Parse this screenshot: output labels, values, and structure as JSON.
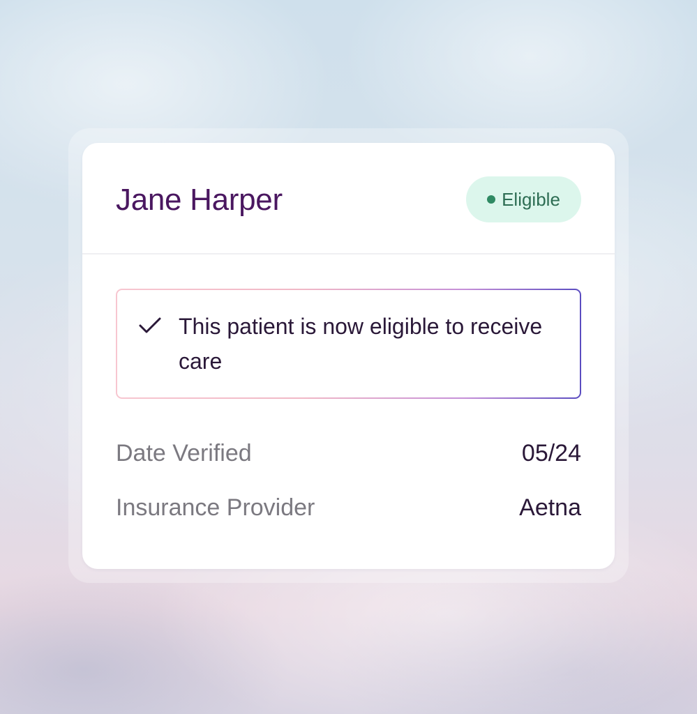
{
  "patient": {
    "name": "Jane Harper"
  },
  "status": {
    "label": "Eligible",
    "color": "#2f8a63",
    "background": "#dcf6ec"
  },
  "notice": {
    "icon": "checkmark-icon",
    "text": "This patient is now eligible to receive care"
  },
  "details": [
    {
      "label": "Date Verified",
      "value": "05/24"
    },
    {
      "label": "Insurance Provider",
      "value": "Aetna"
    }
  ],
  "colors": {
    "name_text": "#4a1760",
    "border_gradient": [
      "#f7c6d0",
      "#c58fd8",
      "#5a4cc0"
    ]
  }
}
